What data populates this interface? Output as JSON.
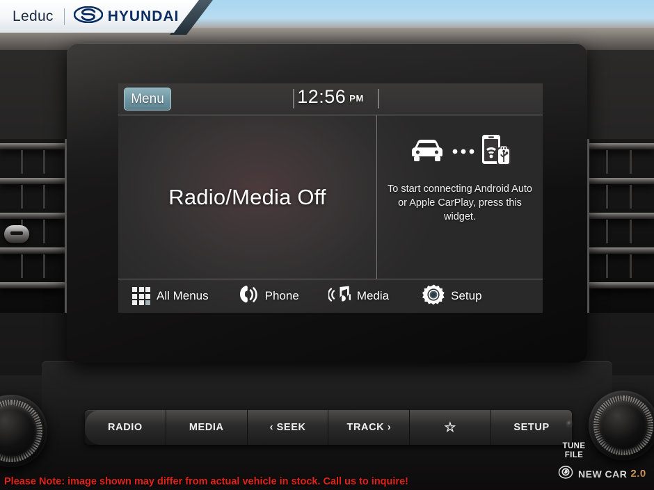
{
  "banner": {
    "dealer_name": "Leduc",
    "brand": "HYUNDAI",
    "separator": "|",
    "logo_icon": "hyundai-logo-icon"
  },
  "infotainment": {
    "menu_button": "Menu",
    "clock": {
      "time": "12:56",
      "meridiem": "PM"
    },
    "left_pane": {
      "status_title": "Radio/Media Off"
    },
    "right_pane": {
      "widget_message": "To start connecting Android Auto or Apple CarPlay, press this widget.",
      "icons": [
        "car-icon",
        "dots-connection-icon",
        "phone-usb-wifi-icon"
      ]
    },
    "shortcuts": [
      {
        "label": "All Menus",
        "icon": "grid-menu-icon"
      },
      {
        "label": "Phone",
        "icon": "phone-handset-icon"
      },
      {
        "label": "Media",
        "icon": "music-note-icon"
      },
      {
        "label": "Setup",
        "icon": "gear-icon"
      }
    ]
  },
  "hardware": {
    "buttons": [
      {
        "label": "RADIO"
      },
      {
        "label": "MEDIA"
      },
      {
        "label": "‹ SEEK"
      },
      {
        "label": "TRACK ›"
      },
      {
        "label": "☆"
      },
      {
        "label": "SETUP"
      }
    ],
    "tune_file_label": "TUNE\nFILE",
    "left_knob": "volume-power-knob",
    "right_knob": "tune-file-knob"
  },
  "footer": {
    "disclaimer": "Please Note: image shown may differ from actual vehicle in stock. Call us to inquire!",
    "badge_text": "NEW CAR",
    "badge_version": "2.0"
  },
  "colors": {
    "brand_navy": "#0a2d62",
    "menu_button": "#6d93a0",
    "disclaimer_red": "#e2231a",
    "screen_bg": "#2f2e2e"
  }
}
